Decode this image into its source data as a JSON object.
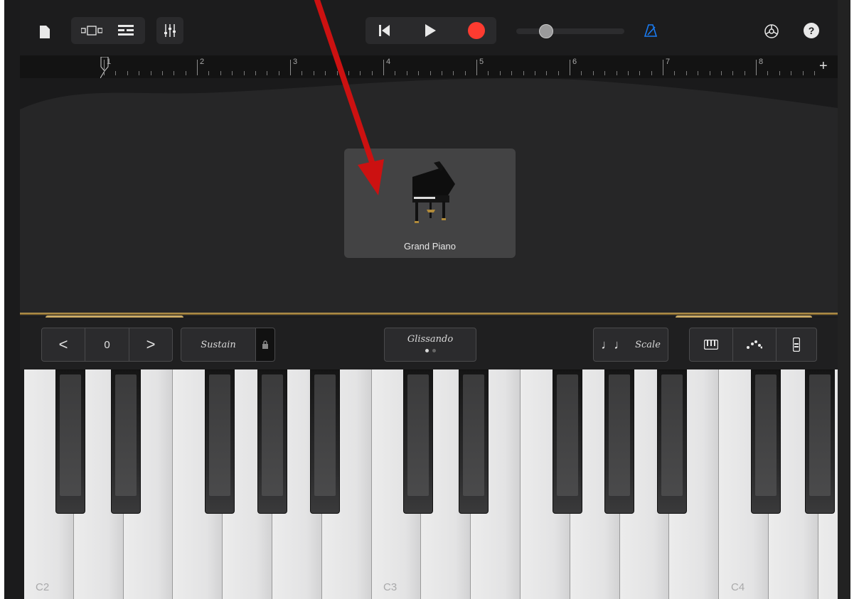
{
  "toolbar": {
    "icons": [
      "document-icon",
      "tracks-view-icon",
      "list-view-icon",
      "mixer-icon",
      "rewind-icon",
      "play-icon",
      "record-icon",
      "metronome-icon",
      "settings-icon",
      "help-icon"
    ],
    "help_label": "?"
  },
  "ruler": {
    "bars": [
      "1",
      "2",
      "3",
      "4",
      "5",
      "6",
      "7",
      "8"
    ],
    "add_label": "+"
  },
  "instrument": {
    "name": "Grand Piano"
  },
  "controls": {
    "octave_value": "0",
    "prev_label": "<",
    "next_label": ">",
    "sustain_label": "Sustain",
    "glissando_label": "Glissando",
    "scale_label": "Scale",
    "scale_icon": "♩♩"
  },
  "keyboard": {
    "labels": [
      "C2",
      "C3",
      "C4"
    ]
  },
  "colors": {
    "record": "#fe3b30",
    "metronome": "#1a7cf3",
    "gold": "#c4a35a",
    "arrow": "#cc1111"
  }
}
